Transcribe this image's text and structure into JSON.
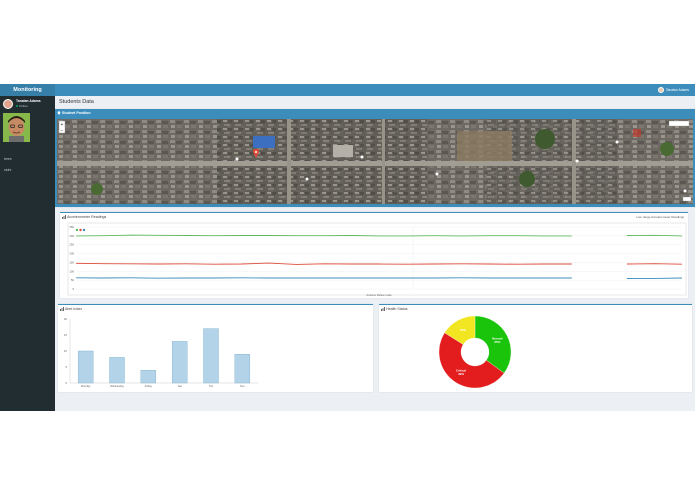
{
  "app": {
    "logo": "Monitoring",
    "user_name": "Tanalan Adams",
    "user_status": "Online",
    "top_user_name": "Tanalan Adams"
  },
  "sidebar": {
    "items": [
      {
        "label": "trees"
      },
      {
        "label": "stuhr"
      }
    ]
  },
  "page": {
    "title": "Students Data"
  },
  "map_panel": {
    "title": "Student Position",
    "marker_icon": "map-pin-icon",
    "colors": {
      "header": "#3c8dbc",
      "marker": "#dd4b39"
    }
  },
  "accelerometer": {
    "title": "Accelerometer Readings",
    "range_label": "Live range Accelerometer Readings",
    "xlabel": "Arduino tilt/acc code"
  },
  "alert_index": {
    "title": "Alert Index"
  },
  "health_status": {
    "title": "Health Status"
  },
  "chart_data": [
    {
      "type": "line",
      "title": "Accelerometer Readings",
      "xlabel": "Arduino tilt/acc code",
      "ylabel": "",
      "ylim": [
        0,
        350
      ],
      "y_ticks": [
        "350",
        "300",
        "250",
        "200",
        "150",
        "100",
        "50",
        "0"
      ],
      "series": [
        {
          "color": "#5cb85c",
          "values": [
            300,
            301,
            304,
            303,
            302,
            301,
            302,
            302,
            301,
            301,
            302,
            300,
            300,
            301,
            300,
            301,
            301,
            300,
            300,
            null,
            302,
            303,
            300
          ]
        },
        {
          "color": "#dd4b39",
          "values": [
            145,
            143,
            142,
            141,
            142,
            140,
            141,
            146,
            139,
            142,
            141,
            141,
            140,
            141,
            142,
            141,
            140,
            141,
            141,
            null,
            141,
            143,
            140
          ]
        },
        {
          "color": "#3c8dbc",
          "values": [
            63,
            62,
            63,
            61,
            62,
            62,
            63,
            62,
            62,
            62,
            62,
            62,
            62,
            62,
            63,
            62,
            62,
            62,
            62,
            null,
            59,
            60,
            62
          ]
        }
      ],
      "grid": true,
      "legend_placement": "top-left"
    },
    {
      "type": "bar",
      "title": "Alert Index",
      "categories": [
        "Monday",
        "Wednesday",
        "Friday",
        "Sat",
        "Thu",
        "Sun"
      ],
      "values": [
        10,
        8,
        4,
        13,
        17,
        9
      ],
      "ylim": [
        0,
        20
      ],
      "y_ticks": [
        "20",
        "15",
        "10",
        "5",
        "0"
      ],
      "colors": {
        "bar": "#b3d4e8",
        "bar_border": "#7aaecb"
      }
    },
    {
      "type": "pie",
      "title": "Health Status",
      "labels": [
        "Normal 35%",
        "Critical 49%",
        "16%"
      ],
      "values": [
        35,
        49,
        16
      ],
      "colors": [
        "#19c40a",
        "#e31d1d",
        "#f2e623"
      ]
    }
  ]
}
